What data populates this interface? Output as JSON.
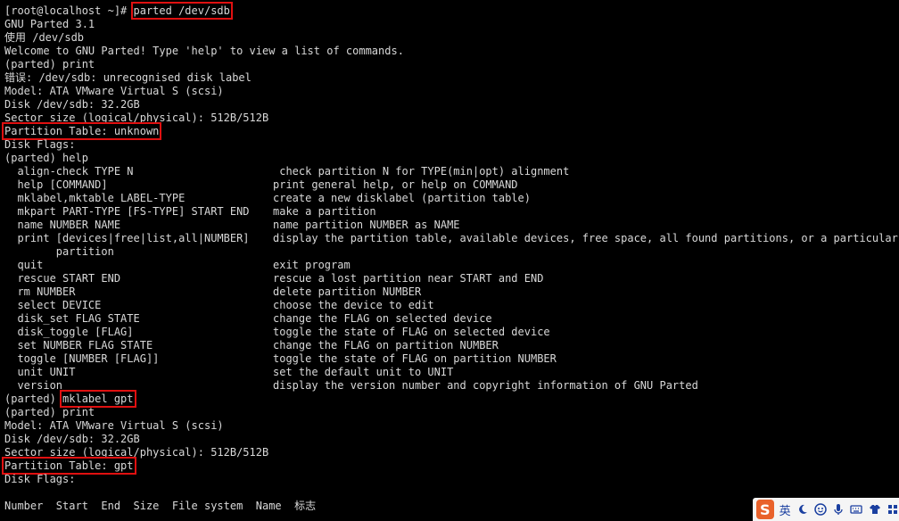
{
  "terminal": {
    "lines": [
      {
        "text": "[root@localhost ~]# ",
        "highlight": "parted /dev/sdb"
      },
      {
        "text": "GNU Parted 3.1"
      },
      {
        "text": "使用 /dev/sdb"
      },
      {
        "text": "Welcome to GNU Parted! Type 'help' to view a list of commands."
      },
      {
        "text": "(parted) print"
      },
      {
        "text": "错误: /dev/sdb: unrecognised disk label"
      },
      {
        "text": "Model: ATA VMware Virtual S (scsi)"
      },
      {
        "text": "Disk /dev/sdb: 32.2GB"
      },
      {
        "text": "Sector size (logical/physical): 512B/512B"
      },
      {
        "text": "",
        "highlight": "Partition Table: unknown"
      },
      {
        "text": "Disk Flags:"
      },
      {
        "text": "(parted) help"
      },
      {
        "cmd": "  align-check TYPE N",
        "desc": " check partition N for TYPE(min|opt) alignment"
      },
      {
        "cmd": "  help [COMMAND]",
        "desc": "print general help, or help on COMMAND"
      },
      {
        "cmd": "  mklabel,mktable LABEL-TYPE",
        "desc": "create a new disklabel (partition table)"
      },
      {
        "cmd": "  mkpart PART-TYPE [FS-TYPE] START END",
        "desc": "make a partition"
      },
      {
        "cmd": "  name NUMBER NAME",
        "desc": "name partition NUMBER as NAME"
      },
      {
        "cmd": "  print [devices|free|list,all|NUMBER]",
        "desc": "display the partition table, available devices, free space, all found partitions, or a particular"
      },
      {
        "cmd": "        partition",
        "desc": ""
      },
      {
        "cmd": "  quit",
        "desc": "exit program"
      },
      {
        "cmd": "  rescue START END",
        "desc": "rescue a lost partition near START and END"
      },
      {
        "cmd": "  rm NUMBER",
        "desc": "delete partition NUMBER"
      },
      {
        "cmd": "  select DEVICE",
        "desc": "choose the device to edit"
      },
      {
        "cmd": "  disk_set FLAG STATE",
        "desc": "change the FLAG on selected device"
      },
      {
        "cmd": "  disk_toggle [FLAG]",
        "desc": "toggle the state of FLAG on selected device"
      },
      {
        "cmd": "  set NUMBER FLAG STATE",
        "desc": "change the FLAG on partition NUMBER"
      },
      {
        "cmd": "  toggle [NUMBER [FLAG]]",
        "desc": "toggle the state of FLAG on partition NUMBER"
      },
      {
        "cmd": "  unit UNIT",
        "desc": "set the default unit to UNIT"
      },
      {
        "cmd": "  version",
        "desc": "display the version number and copyright information of GNU Parted"
      },
      {
        "text": "(parted) ",
        "highlight": "mklabel gpt"
      },
      {
        "text": "(parted) print"
      },
      {
        "text": "Model: ATA VMware Virtual S (scsi)"
      },
      {
        "text": "Disk /dev/sdb: 32.2GB"
      },
      {
        "text": "Sector size (logical/physical): 512B/512B"
      },
      {
        "text": "",
        "highlight": "Partition Table: gpt"
      },
      {
        "text": "Disk Flags:"
      },
      {
        "text": ""
      },
      {
        "text": "Number  Start  End  Size  File system  Name  标志"
      }
    ]
  },
  "ime": {
    "logo": "S",
    "lang": "英",
    "icons": [
      "moon-icon",
      "emoji-icon",
      "microphone-icon",
      "keyboard-icon",
      "shirt-icon",
      "grid-icon"
    ]
  }
}
